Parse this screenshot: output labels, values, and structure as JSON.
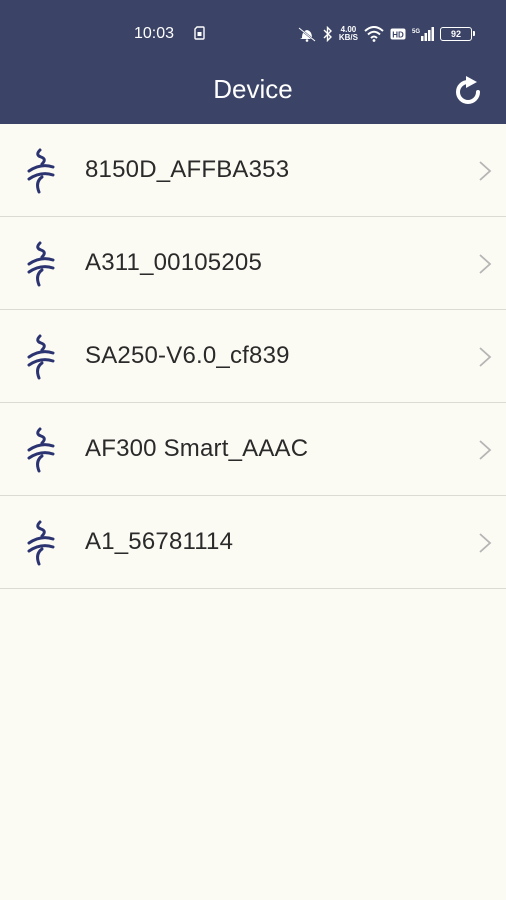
{
  "status_bar": {
    "time": "10:03",
    "net_speed_value": "4.00",
    "net_speed_unit": "KB/S",
    "battery_level": "92"
  },
  "header": {
    "title": "Device",
    "refresh_icon": "refresh-icon"
  },
  "devices": [
    {
      "name": "8150D_AFFBA353",
      "icon": "wave-device-icon"
    },
    {
      "name": "A311_00105205",
      "icon": "wave-device-icon"
    },
    {
      "name": "SA250-V6.0_cf839",
      "icon": "wave-device-icon"
    },
    {
      "name": "AF300 Smart_AAAC",
      "icon": "wave-device-icon"
    },
    {
      "name": "A1_56781114",
      "icon": "wave-device-icon"
    }
  ],
  "colors": {
    "header_bg": "#3b4466",
    "page_bg": "#fcfbf3",
    "icon": "#2b3470",
    "chevron": "#b5b5b5"
  }
}
